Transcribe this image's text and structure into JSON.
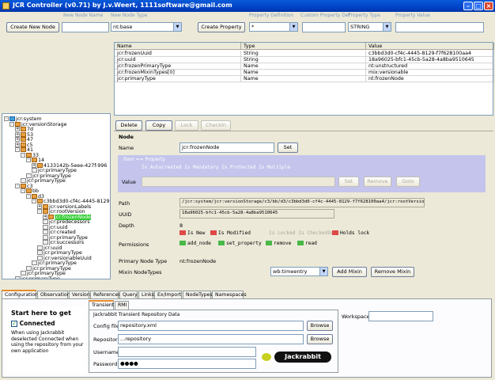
{
  "window": {
    "title": "JCR Controller (v0.71) by J.v.Weert, 1111software@gmail.com"
  },
  "toolbar": {
    "new_node_name_label": "New Node Name",
    "new_node_type_label": "New Node Type",
    "property_definition_label": "Property Definition",
    "custom_property_def_label": "Custom Property Def",
    "property_type_label": "Property Type",
    "property_value_label": "Property Value",
    "create_node_button": "Create New Node",
    "new_node_type_value": "nt:base",
    "create_property_button": "Create Property",
    "property_definition_value": "*",
    "property_type_value": "STRING"
  },
  "tree": {
    "nodes": [
      {
        "label": "jcr:system",
        "icon": "root-node-icon"
      },
      {
        "label": "jcr:versionStorage",
        "icon": "folder-icon"
      },
      {
        "label": "7d",
        "icon": "folder-icon"
      },
      {
        "label": "53",
        "icon": "folder-icon"
      },
      {
        "label": "47",
        "icon": "folder-icon"
      },
      {
        "label": "c5",
        "icon": "folder-icon"
      },
      {
        "label": "41",
        "icon": "folder-icon"
      },
      {
        "label": "33",
        "icon": "folder-icon"
      },
      {
        "label": "14",
        "icon": "folder-icon"
      },
      {
        "label": "4133142b-5eee-427f-996",
        "icon": "folder-icon"
      },
      {
        "label": "jcr:primaryType",
        "icon": "property-icon"
      },
      {
        "label": "jcr:primaryType",
        "icon": "property-icon"
      },
      {
        "label": "jcr:primaryType",
        "icon": "property-icon"
      },
      {
        "label": "c3",
        "icon": "folder-icon"
      },
      {
        "label": "bb",
        "icon": "folder-icon"
      },
      {
        "label": "d3",
        "icon": "folder-icon"
      },
      {
        "label": "c3bbd3d0-cf4c-4445-8129",
        "icon": "folder-icon"
      },
      {
        "label": "jcr:versionLabels",
        "icon": "folder-icon"
      },
      {
        "label": "jcr:rootVersion",
        "icon": "folder-icon"
      },
      {
        "label": "jcr:frozenNode",
        "icon": "folder-icon"
      },
      {
        "label": "jcr:predecessors",
        "icon": "property-icon"
      },
      {
        "label": "jcr:uuid",
        "icon": "property-icon"
      },
      {
        "label": "jcr:created",
        "icon": "property-icon"
      },
      {
        "label": "jcr:primaryType",
        "icon": "property-icon"
      },
      {
        "label": "jcr:successors",
        "icon": "property-icon"
      },
      {
        "label": "jcr:uuid",
        "icon": "property-icon"
      },
      {
        "label": "jcr:primaryType",
        "icon": "property-icon"
      },
      {
        "label": "jcr:versionableUuid",
        "icon": "property-icon"
      },
      {
        "label": "jcr:primaryType",
        "icon": "property-icon"
      },
      {
        "label": "jcr:primaryType",
        "icon": "property-icon"
      },
      {
        "label": "jcr:primaryType",
        "icon": "property-icon"
      },
      {
        "label": "jcr:primaryType",
        "icon": "property-icon"
      }
    ]
  },
  "properties": {
    "columns": [
      "Name",
      "Type",
      "Value"
    ],
    "rows": [
      [
        "jcr:frozenUuid",
        "String",
        "c3bbd3d0-cf4c-4445-8129-f7f628100aa4"
      ],
      [
        "jcr:uuid",
        "String",
        "18a96025-bfc1-45cb-5a28-4a8ba9510645"
      ],
      [
        "jcr:frozenPrimaryType",
        "Name",
        "nt:unstructured"
      ],
      [
        "jcr:frozenMixinTypes[0]",
        "Name",
        "mix:versionable"
      ],
      [
        "jcr:primaryType",
        "Name",
        "nt:frozenNode"
      ]
    ]
  },
  "node_panel": {
    "delete_button": "Delete",
    "copy_button": "Copy",
    "lock_button": "Lock",
    "checkin_button": "CheckIn",
    "section_title": "Node",
    "name_label": "Name",
    "name_value": "jcr:frozenNode",
    "set_button": "Set",
    "item_property_label": "Item == Property",
    "item_warning": "Is Autocreated  Is Mandatory  Is Protected  Is Multiple",
    "value_label": "Value",
    "value_set_button": "Set",
    "remove_button": "Remove",
    "goto_button": "Goto",
    "path_label": "Path",
    "path_value": "/jcr:system/jcr:versionStorage/c3/bb/d3/c3bbd3d0-cf4c-4445-8129-f7f628100aa4/jcr:rootVersion/jcr:frozenNode",
    "uuid_label": "UUID",
    "uuid_value": "18a96025-bfc1-45cb-5a28-4a8ba9510645",
    "depth_label": "Depth",
    "depth_value": "8",
    "is_new": "Is New",
    "is_modified": "Is Modified",
    "is_locked": "Is Locked  Is CheckedOut",
    "holds_lock": "Holds lock",
    "permissions_label": "Permissions",
    "perm_add_node": "add_node",
    "perm_set_property": "set_property",
    "perm_remove": "remove",
    "perm_read": "read",
    "primary_node_type_label": "Primary Node Type",
    "primary_node_type_value": "nt:frozenNode",
    "mixin_label": "Mixin NodeTypes",
    "mixin_combo_value": "wb:timeentry",
    "add_mixin_button": "Add Mixin",
    "remove_mixin_button": "Remove Mixin"
  },
  "bottom_tabs": [
    "Configuration",
    "Observation",
    "Version",
    "References",
    "Query",
    "Links",
    "Ex/Import",
    "NodeTypes",
    "Namespaces"
  ],
  "repo_tabs": [
    "Transient",
    "RMI"
  ],
  "config": {
    "start_title": "Start here to get",
    "connected_label": "Connected",
    "help_text": "When using Jackrabbit deselected Connected when using the repository from your own application",
    "section_title": "Jackrabbit Transient Repository Data",
    "config_file_label": "Config file",
    "config_file_value": "repository.xml",
    "browse_button": "Browse",
    "repository_label": "Repository",
    "repository_value": "...repository",
    "username_label": "Username",
    "password_label": "Password",
    "password_value": "●●●●",
    "workspace_label": "Workspace",
    "logo_text": "Jackrabbit"
  },
  "colors": {
    "selected_node": "#33cc33",
    "accent": "#0042c8",
    "item_box": "#c4c4ec"
  }
}
